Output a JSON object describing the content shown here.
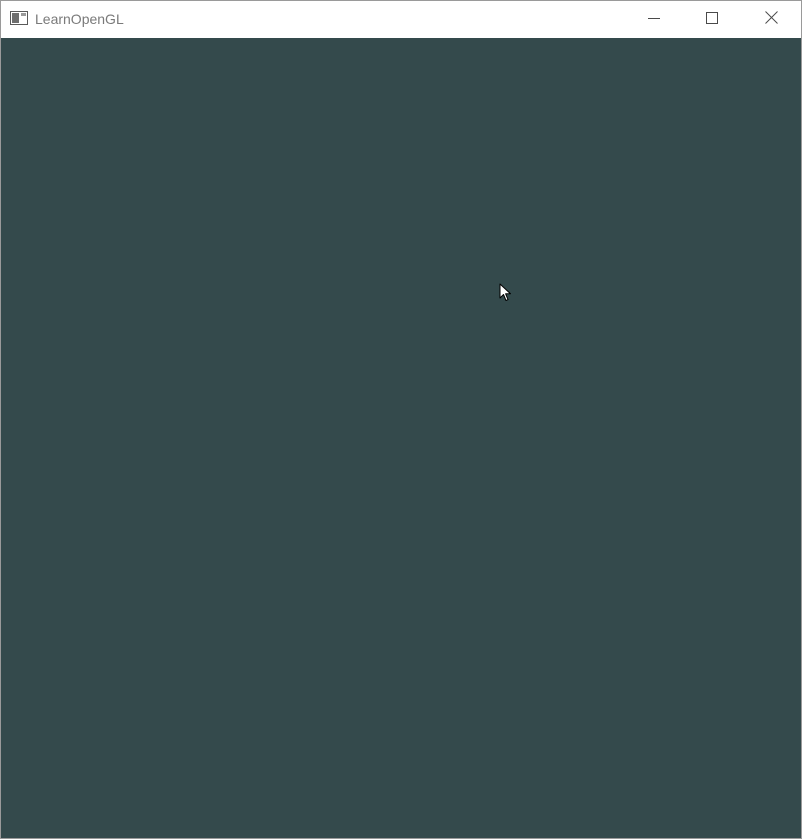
{
  "window": {
    "title": "LearnOpenGL"
  },
  "icons": {
    "app": "app-window-icon",
    "minimize": "minimize-icon",
    "maximize": "maximize-icon",
    "close": "close-icon",
    "cursor": "mouse-cursor-icon"
  },
  "colors": {
    "clear_color": "#344a4c",
    "titlebar": "#ffffff",
    "title_text": "#7a7a7a",
    "caption_glyph": "#4a4a4a"
  }
}
